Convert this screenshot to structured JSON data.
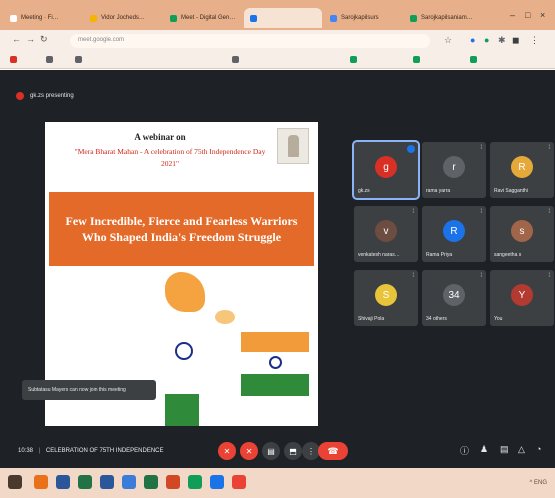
{
  "browser": {
    "tabs": [
      {
        "label": "Meeting · Fi…",
        "color": "#ffffff",
        "active": false
      },
      {
        "label": "Vidor Jocheds…",
        "color": "#f4b400",
        "active": false
      },
      {
        "label": "Meet - Digital Gen…",
        "color": "#0f9d58",
        "active": false
      },
      {
        "label": "",
        "color": "#1a73e8",
        "active": true
      },
      {
        "label": "Sarojkapilsurs",
        "color": "#4285f4",
        "active": false
      },
      {
        "label": "Sarojkapilsaniam…",
        "color": "#0f9d58",
        "active": false
      }
    ],
    "window_controls": [
      "–",
      "□",
      "×"
    ],
    "address": "meet.google.com"
  },
  "meet": {
    "presenter_text": "gk.zs presenting",
    "slide": {
      "kicker": "A webinar on",
      "subtitle": "\"Mera Bharat Mahan - A celebration of 75th Independence Day 2021\"",
      "banner": "Few Incredible, Fierce and Fearless Warriors Who Shaped India's Freedom Struggle"
    },
    "toast": "Subtatasu Mayers can now join this meeting",
    "participants": [
      {
        "name": "gk.zs",
        "initial": "g",
        "color": "#d93025",
        "speaking": true
      },
      {
        "name": "rama yarra",
        "initial": "r",
        "color": "#5f6368",
        "speaking": false
      },
      {
        "name": "Ravi Sagganthi",
        "initial": "R",
        "color": "#e5a93a",
        "speaking": false
      },
      {
        "name": "venkatesh naras…",
        "initial": "v",
        "color": "#6d4c41",
        "speaking": false
      },
      {
        "name": "Rama Priya",
        "initial": "R",
        "color": "#1a73e8",
        "speaking": false
      },
      {
        "name": "sangeetha s",
        "initial": "s",
        "color": "#a1664a",
        "speaking": false
      },
      {
        "name": "Shivaji Pola",
        "initial": "S",
        "color": "#e8c43a",
        "speaking": false
      },
      {
        "name": "34 others",
        "initial": "34",
        "color": "#5f6368",
        "speaking": false
      },
      {
        "name": "You",
        "initial": "Y",
        "color": "#b23a30",
        "speaking": false
      }
    ],
    "meeting_time": "10:38",
    "meeting_title": "CELEBRATION OF 75TH INDEPENDENCE",
    "controls": [
      "mic",
      "cam",
      "cc",
      "present",
      "more"
    ],
    "right_controls": [
      "info",
      "people",
      "chat",
      "activities",
      "lock"
    ]
  },
  "taskbar": {
    "apps": [
      "#e8711a",
      "#2b579a",
      "#217346",
      "#2b579a",
      "#3c7cd9",
      "#217346",
      "#d24726",
      "#0f9d58",
      "#1a73e8",
      "#ea4335"
    ],
    "tray_text": "^ ENG"
  }
}
